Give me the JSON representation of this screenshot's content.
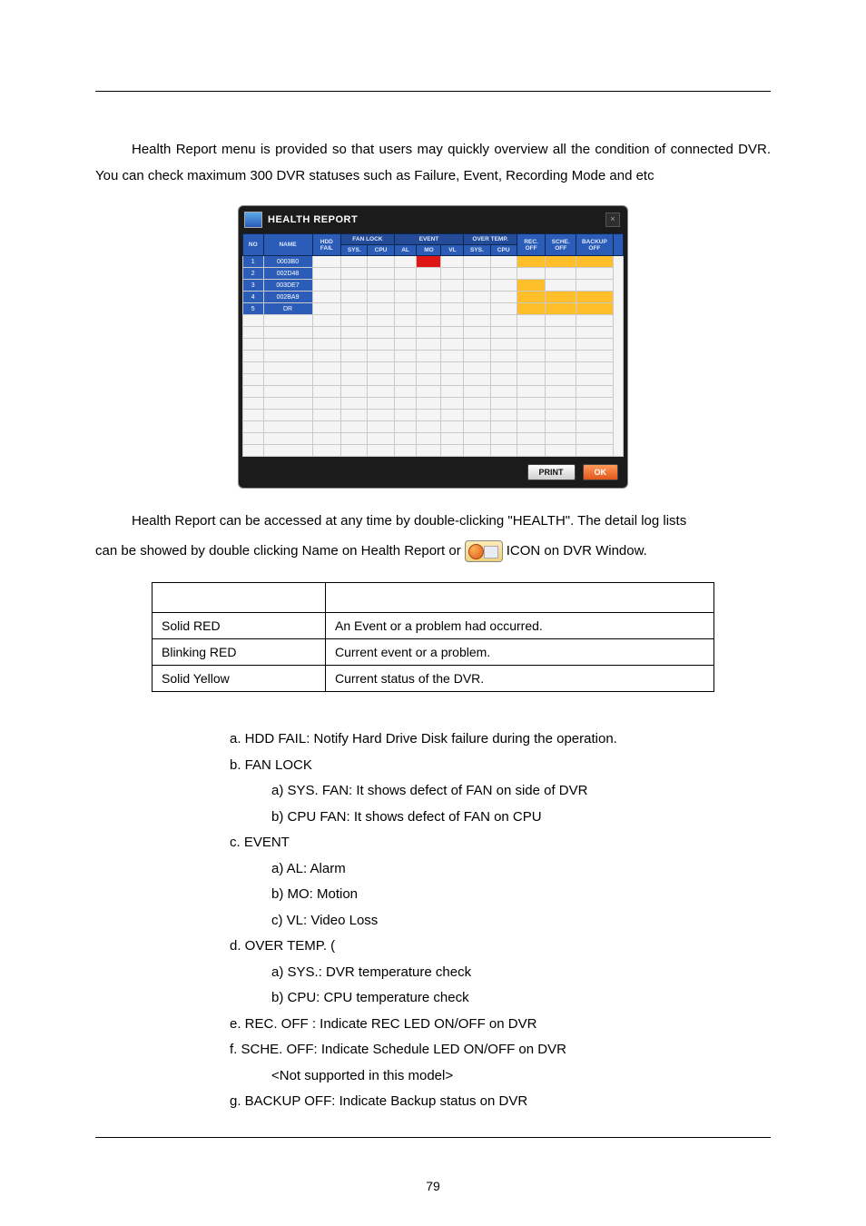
{
  "intro": "Health Report menu is provided so that users may quickly overview all the condition of connected DVR. You can check maximum 300 DVR statuses such as Failure, Event, Recording Mode and etc",
  "figure": {
    "title": "HEALTH REPORT",
    "close": "×",
    "headers": {
      "no": "NO",
      "name": "NAME",
      "hdd": "HDD FAIL",
      "fanlock": "FAN LOCK",
      "fan_sys": "SYS.",
      "fan_cpu": "CPU",
      "event": "EVENT",
      "ev_al": "AL",
      "ev_mo": "MO",
      "ev_vl": "VL",
      "overtemp": "OVER TEMP.",
      "ot_sys": "SYS.",
      "ot_cpu": "CPU",
      "rec": "REC. OFF",
      "sche": "SCHE. OFF",
      "backup": "BACKUP OFF"
    },
    "rows": [
      {
        "no": "1",
        "name": "0003B0",
        "mo": "red",
        "rec": "yellow",
        "sche": "yellow",
        "backup": "yellow"
      },
      {
        "no": "2",
        "name": "002D48",
        "mo": "",
        "rec": "",
        "sche": "",
        "backup": ""
      },
      {
        "no": "3",
        "name": "003DE7",
        "mo": "",
        "rec": "yellow",
        "sche": "",
        "backup": ""
      },
      {
        "no": "4",
        "name": "002BA9",
        "mo": "",
        "rec": "yellow",
        "sche": "yellow",
        "backup": "yellow"
      },
      {
        "no": "5",
        "name": "DR",
        "mo": "",
        "rec": "yellow",
        "sche": "yellow",
        "backup": "yellow"
      }
    ],
    "btn_print": "PRINT",
    "btn_ok": "OK"
  },
  "para2a": "Health Report can be accessed at any time by double-clicking   \"HEALTH\".   The detail log lists",
  "para2b_before": "can be showed by double clicking Name on Health Report or ",
  "para2b_after": " ICON on DVR Window.",
  "status_table": {
    "r1c1": "Solid RED",
    "r1c2": "An Event or a problem had occurred.",
    "r2c1": "Blinking RED",
    "r2c2": "Current event or a problem.",
    "r3c1": "Solid Yellow",
    "r3c2": "Current status of the DVR."
  },
  "outline": {
    "a": "a.   HDD FAIL: Notify Hard Drive Disk failure during the operation.",
    "b": "b.   FAN LOCK",
    "b1": "a)   SYS. FAN: It shows defect of FAN on side of DVR",
    "b2": "b)   CPU FAN: It shows defect of FAN on CPU",
    "c": "c.   EVENT",
    "c1": "a)   AL:   Alarm",
    "c2": "b)   MO:   Motion",
    "c3": "c)   VL:   Video Loss",
    "d": "d.   OVER TEMP. (",
    "d1": "a)   SYS.: DVR temperature check",
    "d2": "b)   CPU: CPU temperature check",
    "e": "e.   REC. OFF : Indicate REC LED ON/OFF on DVR",
    "f": "f.    SCHE. OFF: Indicate Schedule LED ON/OFF on DVR",
    "fnote": "<Not supported in this model>",
    "g": "g.   BACKUP OFF: Indicate Backup status on DVR"
  },
  "pagenum": "79"
}
